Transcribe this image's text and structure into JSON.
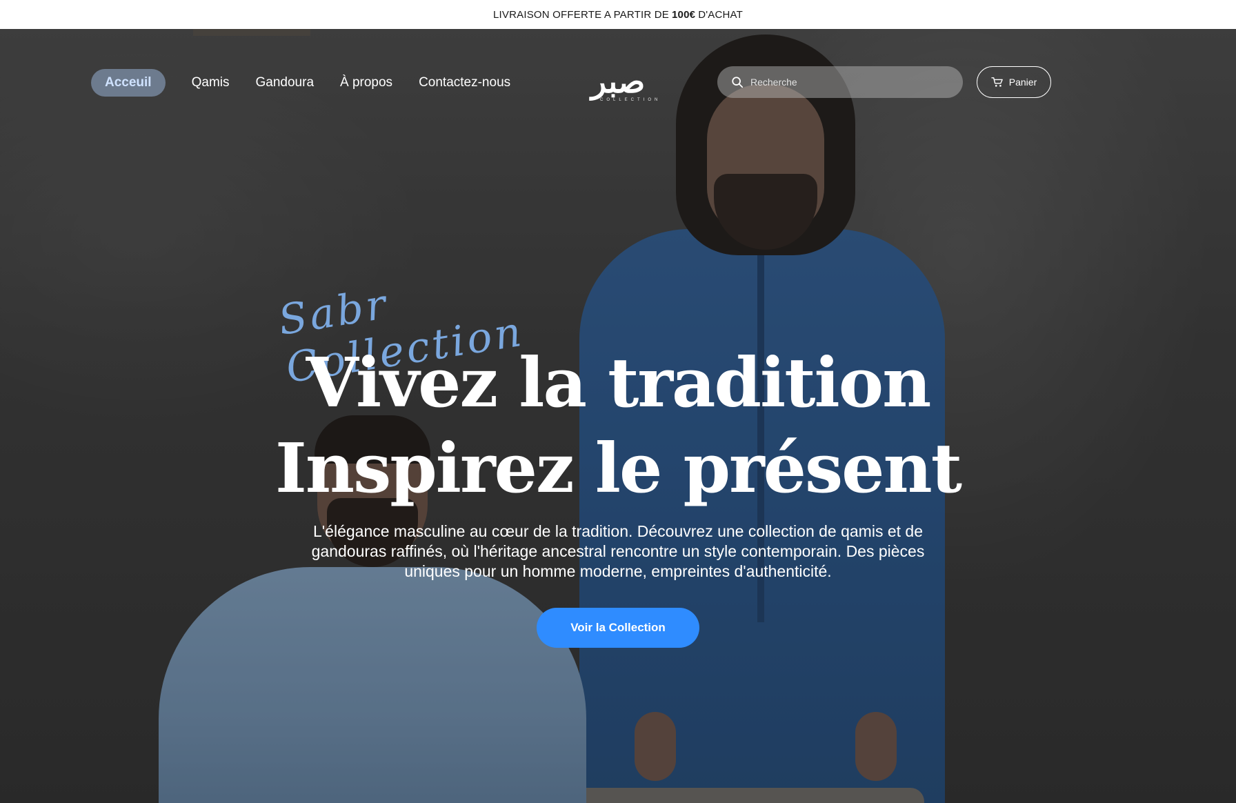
{
  "announcement": {
    "prefix": "LIVRAISON OFFERTE A PARTIR DE",
    "amount": "100€",
    "suffix": "D'ACHAT"
  },
  "nav": {
    "items": [
      {
        "label": "Acceuil",
        "active": true
      },
      {
        "label": "Qamis",
        "active": false
      },
      {
        "label": "Gandoura",
        "active": false
      },
      {
        "label": "À propos",
        "active": false
      },
      {
        "label": "Contactez-nous",
        "active": false
      }
    ],
    "logo": {
      "arabic": "صبر",
      "subtitle": "COLLECTION"
    },
    "search": {
      "placeholder": "Recherche",
      "icon": "search-icon"
    },
    "cart": {
      "label": "Panier",
      "icon": "cart-icon"
    }
  },
  "hero": {
    "script": "Sabr Collection",
    "headline_1": "Vivez la tradition",
    "headline_2": "Inspirez le présent",
    "description": "L'élégance masculine au cœur de la tradition. Découvrez une collection de qamis et de gandouras raffinés, où l'héritage ancestral rencontre un style contemporain. Des pièces uniques pour un homme moderne, empreintes d'authenticité.",
    "cta_label": "Voir la Collection"
  },
  "colors": {
    "accent": "#2f8cff",
    "script": "#7eaee8",
    "nav_active_bg": "#96afd2"
  }
}
